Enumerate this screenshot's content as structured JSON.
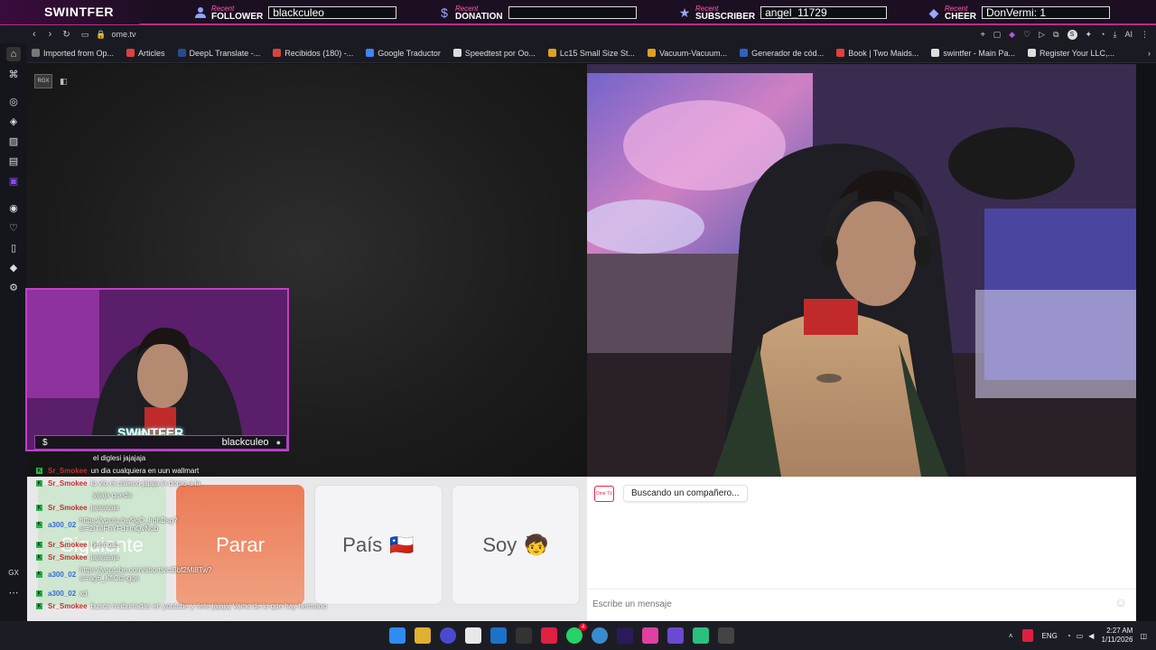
{
  "overlay": {
    "brand": "SWINTFER",
    "recent_label": "Recent",
    "follower_label": "FOLLOWER",
    "follower_value": "blackculeo",
    "donation_label": "DONATION",
    "donation_value": "",
    "subscriber_label": "SUBSCRIBER",
    "subscriber_value": "angel_11729",
    "cheer_label": "CHEER",
    "cheer_value": "DonVermi: 1"
  },
  "browser": {
    "url": "ome.tv",
    "ai_label": "AI",
    "bookmarks": [
      {
        "label": "Imported from Op...",
        "color": "#777777"
      },
      {
        "label": "Articles",
        "color": "#e04040"
      },
      {
        "label": "DeepL Translate -...",
        "color": "#2a4a8a"
      },
      {
        "label": "Recibidos (180) -...",
        "color": "#d44638"
      },
      {
        "label": "Google Traductor",
        "color": "#4285f4"
      },
      {
        "label": "Speedtest por Oo...",
        "color": "#dddddd"
      },
      {
        "label": "Lc15 Small Size St...",
        "color": "#e0a020"
      },
      {
        "label": "Vacuum-Vacuum...",
        "color": "#e0a020"
      },
      {
        "label": "Generador de cód...",
        "color": "#3060c0"
      },
      {
        "label": "Book | Two Maids...",
        "color": "#e04040"
      },
      {
        "label": "swintfer - Main Pa...",
        "color": "#dddddd"
      },
      {
        "label": "Register Your LLC,...",
        "color": "#dddddd"
      }
    ],
    "sidebar_gx": "GX"
  },
  "left_video": {
    "badge": "RGX"
  },
  "cam": {
    "brand": "SWINTFER",
    "follower": "blackculeo"
  },
  "stream_chat": [
    {
      "user": "",
      "msg": "el diglesi jajajaja",
      "color": "#c03030"
    },
    {
      "user": "Sr_Smokee",
      "msg": "un dia cualquiera en uun wallmart",
      "color": "#c03030"
    },
    {
      "user": "Sr_Smokee",
      "msg": "lo vio el chileno jajaja la domo a la",
      "color": "#c03030"
    },
    {
      "user": "",
      "msg": "jajaja queda",
      "color": "#c03030"
    },
    {
      "user": "Sr_Smokee",
      "msg": "jajajajaja",
      "color": "#c03030"
    },
    {
      "user": "a300_02",
      "msg": "https://youtu.be/9gO_lrqhDsg?si=2IT3FhYFdTmQvNob",
      "color": "#3a6ad0"
    },
    {
      "user": "Sr_Smokee",
      "msg": "hermoso",
      "color": "#c03030"
    },
    {
      "user": "Sr_Smokee",
      "msg": "jajajajaja",
      "color": "#c03030"
    },
    {
      "user": "a300_02",
      "msg": "https://youtube.com/shorts/ctBbf2Ml8Tw?si=ag6_KflCdt-gqe",
      "color": "#3a6ad0"
    },
    {
      "user": "a300_02",
      "msg": "xd",
      "color": "#3a6ad0"
    },
    {
      "user": "Sr_Smokee",
      "msg": "busca maburradas en youtube y riete jajajaj Vamo de lo que hay hermano",
      "color": "#c03030"
    },
    {
      "user": "",
      "msg": "que tengas buen stream ahí estamos al habla !!",
      "color": "#ffffff"
    }
  ],
  "controls": {
    "next_label": "Siguiente",
    "stop_label": "Parar",
    "country_label": "País",
    "country_flag": "🇨🇱",
    "gender_label": "Soy",
    "gender_emoji": "🧒"
  },
  "chat": {
    "status": "Buscando un compañero...",
    "logo_text": "Ome TV",
    "placeholder": "Escribe un mensaje"
  },
  "taskbar": {
    "lang": "ENG",
    "time": "2:27 AM",
    "date": "1/11/2026",
    "badge": "4"
  }
}
